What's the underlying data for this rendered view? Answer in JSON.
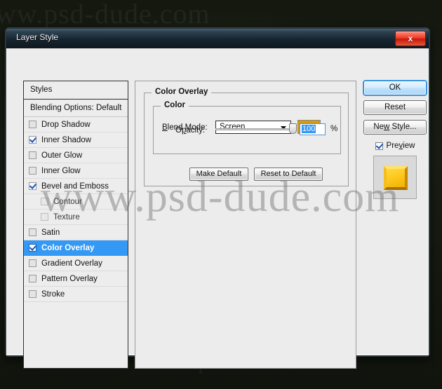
{
  "watermark": {
    "top": "www.psd-dude.com",
    "center": "www.psd-dude.com",
    "bottom": "www.psd-dude.com"
  },
  "window": {
    "title": "Layer Style",
    "close_label": "x"
  },
  "styles_panel": {
    "header": "Styles",
    "blending_options": "Blending Options: Default",
    "items": [
      {
        "label": "Drop Shadow",
        "checked": false,
        "indent": false,
        "selected": false,
        "dim": false
      },
      {
        "label": "Inner Shadow",
        "checked": true,
        "indent": false,
        "selected": false,
        "dim": false
      },
      {
        "label": "Outer Glow",
        "checked": false,
        "indent": false,
        "selected": false,
        "dim": false
      },
      {
        "label": "Inner Glow",
        "checked": false,
        "indent": false,
        "selected": false,
        "dim": false
      },
      {
        "label": "Bevel and Emboss",
        "checked": true,
        "indent": false,
        "selected": false,
        "dim": false
      },
      {
        "label": "Contour",
        "checked": false,
        "indent": true,
        "selected": false,
        "dim": true
      },
      {
        "label": "Texture",
        "checked": false,
        "indent": true,
        "selected": false,
        "dim": true
      },
      {
        "label": "Satin",
        "checked": false,
        "indent": false,
        "selected": false,
        "dim": false
      },
      {
        "label": "Color Overlay",
        "checked": true,
        "indent": false,
        "selected": true,
        "dim": false
      },
      {
        "label": "Gradient Overlay",
        "checked": false,
        "indent": false,
        "selected": false,
        "dim": false
      },
      {
        "label": "Pattern Overlay",
        "checked": false,
        "indent": false,
        "selected": false,
        "dim": false
      },
      {
        "label": "Stroke",
        "checked": false,
        "indent": false,
        "selected": false,
        "dim": false
      }
    ]
  },
  "options": {
    "group_title": "Color Overlay",
    "subgroup_title": "Color",
    "blend_mode_label": "Blend Mode:",
    "blend_mode_value": "Screen",
    "color_swatch_hex": "#d39b0d",
    "opacity_label": "Opacity:",
    "opacity_value": "100",
    "opacity_unit": "%",
    "opacity_percent": 100,
    "make_default_label": "Make Default",
    "reset_to_default_label": "Reset to Default"
  },
  "right_buttons": {
    "ok_label": "OK",
    "reset_label": "Reset",
    "new_style_label": "New Style...",
    "preview_label": "Preview",
    "preview_checked": true
  },
  "colors": {
    "selection_blue": "#3399f5",
    "ok_accent": "#3fa0ea",
    "titlebar_dark": "#16242f",
    "close_red": "#ef3d28",
    "swatch_gold": "#d39b0d"
  }
}
